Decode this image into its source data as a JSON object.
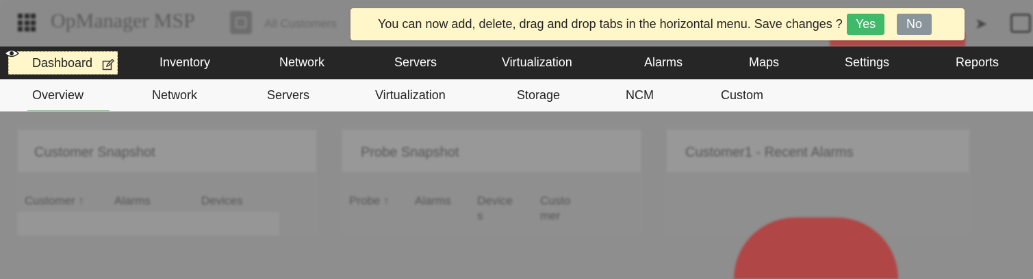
{
  "app": {
    "title": "OpManager MSP",
    "customer_selector": "All Customers"
  },
  "notification": {
    "message": "You can now add, delete, drag and drop tabs in the horizontal menu. Save changes ?",
    "yes_label": "Yes",
    "no_label": "No"
  },
  "main_nav": {
    "items": [
      "Dashboard",
      "Inventory",
      "Network",
      "Servers",
      "Virtualization",
      "Alarms",
      "Maps",
      "Settings",
      "Reports"
    ],
    "active": "Dashboard"
  },
  "sub_nav": {
    "items": [
      "Overview",
      "Network",
      "Servers",
      "Virtualization",
      "Storage",
      "NCM",
      "Custom"
    ],
    "active": "Overview"
  },
  "widgets": [
    {
      "title": "Customer Snapshot",
      "columns": [
        "Customer ↑",
        "Alarms",
        "Devices"
      ]
    },
    {
      "title": "Probe Snapshot",
      "columns": [
        "Probe ↑",
        "Alarms",
        "Device s",
        "Custo mer"
      ]
    },
    {
      "title": "Customer1 - Recent Alarms",
      "columns": []
    }
  ],
  "colors": {
    "notify_bg": "#fff7c9",
    "yes": "#3fba6a",
    "no": "#8a959b",
    "nav_bg": "#262626"
  }
}
